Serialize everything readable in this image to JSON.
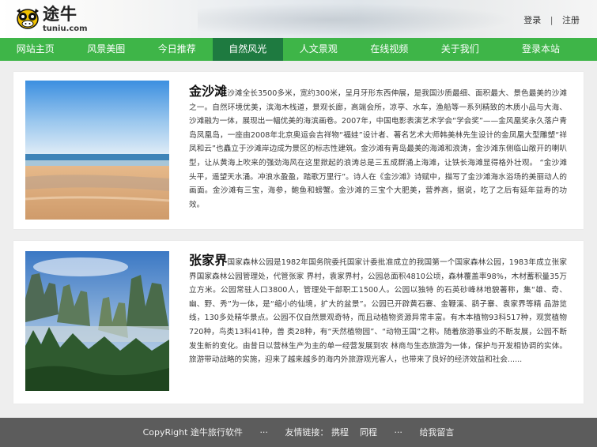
{
  "header": {
    "brand": "途牛",
    "domain": "tuniu.com",
    "login": "登录",
    "separator": "|",
    "register": "注册"
  },
  "nav": {
    "items": [
      "网站主页",
      "风景美图",
      "今日推荐",
      "自然风光",
      "人文景观",
      "在线视频",
      "关于我们",
      "登录本站"
    ],
    "active": "自然风光",
    "active_color": "#1e7a40",
    "bar_color": "#3eb548"
  },
  "articles": [
    {
      "title": "金沙滩",
      "image": "beach-photo",
      "body": "沙滩全长3500多米，宽约300米，呈月牙形东西伸展，是我国沙质最细、面积最大、景色最美的沙滩之一。自然环境优美，滨海木栈道，景观长廊，高端会所，凉亭、水车，渔船等一系列精致的木质小品与大海、沙滩融为一体，展现出一幅优美的海滨画卷。2007年，中国电影表演艺术学会“学会奖”——金风凰奖永久落户青岛凤凰岛，一座由2008年北京奥运会吉祥物“福娃”设计者、著名艺术大师韩美林先生设计的金凤凰大型雕塑“祥凤和云”也矗立于沙滩岸边成为景区的标志性建筑。金沙滩有青岛最美的海滩和浪涛，金沙滩东侧临山敞开的喇叭型，让从黄海上吹来的强劲海风在这里掀起的浪涛总是三五成群涌上海滩，让铁长海滩显得格外壮观。          “金沙滩头平，遥望天水涌。冲浪水盈盈，踏歌万里行”。诗人在《金沙滩》诗赋中，描写了金沙滩海水浴场的美丽动人的画面。金沙滩有三宝，海参，鲍鱼和螃蟹。金沙滩的三宝个大肥美，营养高，据说，吃了之后有延年益寿的功效。"
    },
    {
      "title": "张家界",
      "image": "mountain-photo",
      "body": "国家森林公园是1982年国务院委托国家计委批准成立的我国第一个国家森林公园，1983年成立张家界国家森林公园管理处，代管张家  界村，袁家界村，公园总面积4810公顷，森林覆盖率98%，木材蓄积量35万立方米。公园常驻人口3800人，管理处干部职工1500人。公园以独特   的石英砂峰林地貌著称，集“雄、奇、幽、野、秀”为一体，是“缩小的仙境，扩大的盆景”。公园已开辟黄石寨、金鞭溪、鹞子寨、袁家界等精  品游览线，130多处精华景点。公园不仅自然景观奇特，而且动植物资源异常丰富。有木本植物93科517种，观赏植物720种，鸟类13科41种，兽  类28种，有“天然植物园”、“动物王国”之称。随着旅游事业的不断发展，公园不断发生新的变化。由昔日以营林生产为主的单一经营发展到农  林商与生态旅游为一体，保护与开发相协调的实体。旅游带动战略的实施，迎来了越来越多的海内外旅游观光客人，也带来了良好的经济效益和社会......"
    }
  ],
  "footer": {
    "copyright": "CopyRight 途牛旅行软件",
    "dots1": "···",
    "links_label": "友情链接：",
    "link1": "携程",
    "link2": "同程",
    "dots2": "···",
    "message": "给我留言"
  }
}
